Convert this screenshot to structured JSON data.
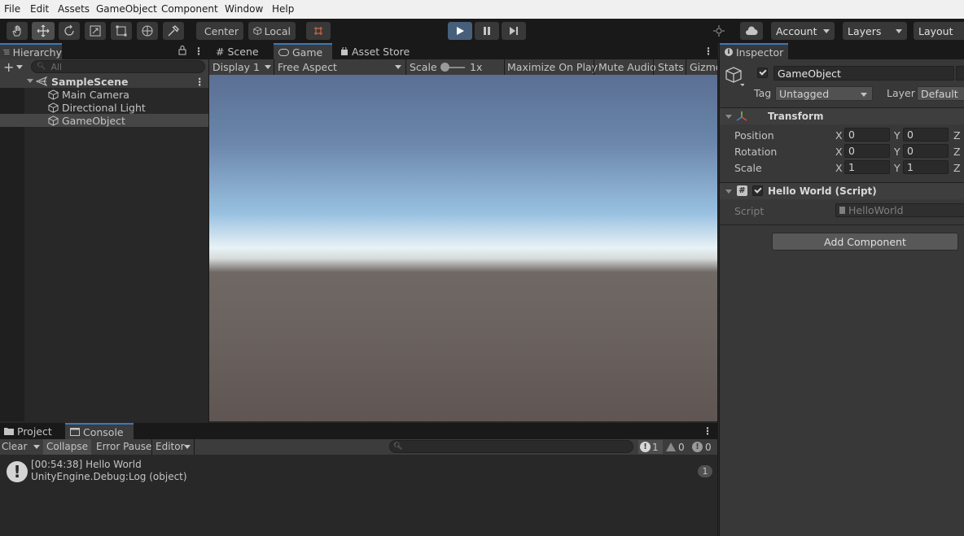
{
  "menu": [
    "File",
    "Edit",
    "Assets",
    "GameObject",
    "Component",
    "Window",
    "Help"
  ],
  "toolbar": {
    "pivot_label": "Center",
    "space_label": "Local",
    "account_label": "Account",
    "layers_label": "Layers",
    "layout_label": "Layout"
  },
  "hierarchy": {
    "tab_label": "Hierarchy",
    "search_placeholder": "All",
    "scene_name": "SampleScene",
    "items": [
      "Main Camera",
      "Directional Light",
      "GameObject"
    ]
  },
  "game_view": {
    "tabs": [
      "Scene",
      "Game",
      "Asset Store"
    ],
    "display_label": "Display 1",
    "aspect_label": "Free Aspect",
    "scale_label": "Scale",
    "scale_value": "1x",
    "maximize_label": "Maximize On Play",
    "mute_label": "Mute Audio",
    "stats_label": "Stats",
    "gizmos_label": "Gizmo"
  },
  "inspector": {
    "tab_label": "Inspector",
    "object_name": "GameObject",
    "tag_label": "Tag",
    "tag_value": "Untagged",
    "layer_label": "Layer",
    "layer_value": "Default",
    "transform_title": "Transform",
    "rows": [
      {
        "label": "Position",
        "x": "0",
        "y": "0"
      },
      {
        "label": "Rotation",
        "x": "0",
        "y": "0"
      },
      {
        "label": "Scale",
        "x": "1",
        "y": "1"
      }
    ],
    "axis_x": "X",
    "axis_y": "Y",
    "axis_z": "Z",
    "script_component_title": "Hello World (Script)",
    "script_label": "Script",
    "script_value": "HelloWorld",
    "add_component_label": "Add Component"
  },
  "console": {
    "tabs": [
      "Project",
      "Console"
    ],
    "clear_label": "Clear",
    "collapse_label": "Collapse",
    "error_pause_label": "Error Pause",
    "editor_label": "Editor",
    "log_count": "1",
    "warn_count": "0",
    "error_count": "0",
    "entry_line1": "[00:54:38] Hello World",
    "entry_line2": "UnityEngine.Debug:Log (object)",
    "entry_count": "1"
  },
  "colors": {
    "play_accent": "#46607c",
    "tab_underline": "#3a79bb"
  }
}
